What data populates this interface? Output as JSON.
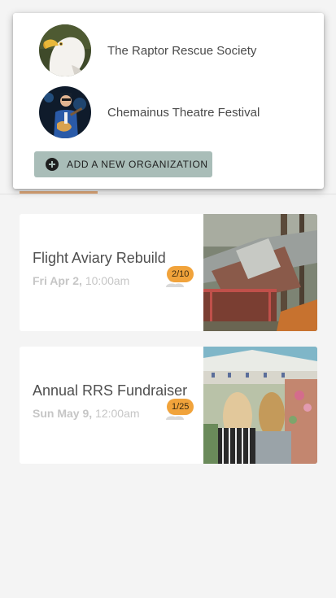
{
  "organizations": [
    {
      "name": "The Raptor Rescue Society",
      "avatar": "bald-eagle-photo"
    },
    {
      "name": "Chemainus Theatre Festival",
      "avatar": "guitarist-on-stage-photo"
    }
  ],
  "add_org_label": "ADD A NEW ORGANIZATION",
  "events": [
    {
      "title": "Flight Aviary Rebuild",
      "day": "Fri Apr 2,",
      "time": "10:00am",
      "count": "2/10",
      "image": "collapsed-shed-photo"
    },
    {
      "title": "Annual RRS Fundraiser",
      "day": "Sun May 9,",
      "time": "12:00am",
      "count": "1/25",
      "image": "festival-crowd-photo"
    }
  ],
  "colors": {
    "accent": "#f1a33b",
    "button_bg": "#a9bdb8",
    "tab_underline": "#e0a878",
    "background": "#f4f4f4"
  }
}
